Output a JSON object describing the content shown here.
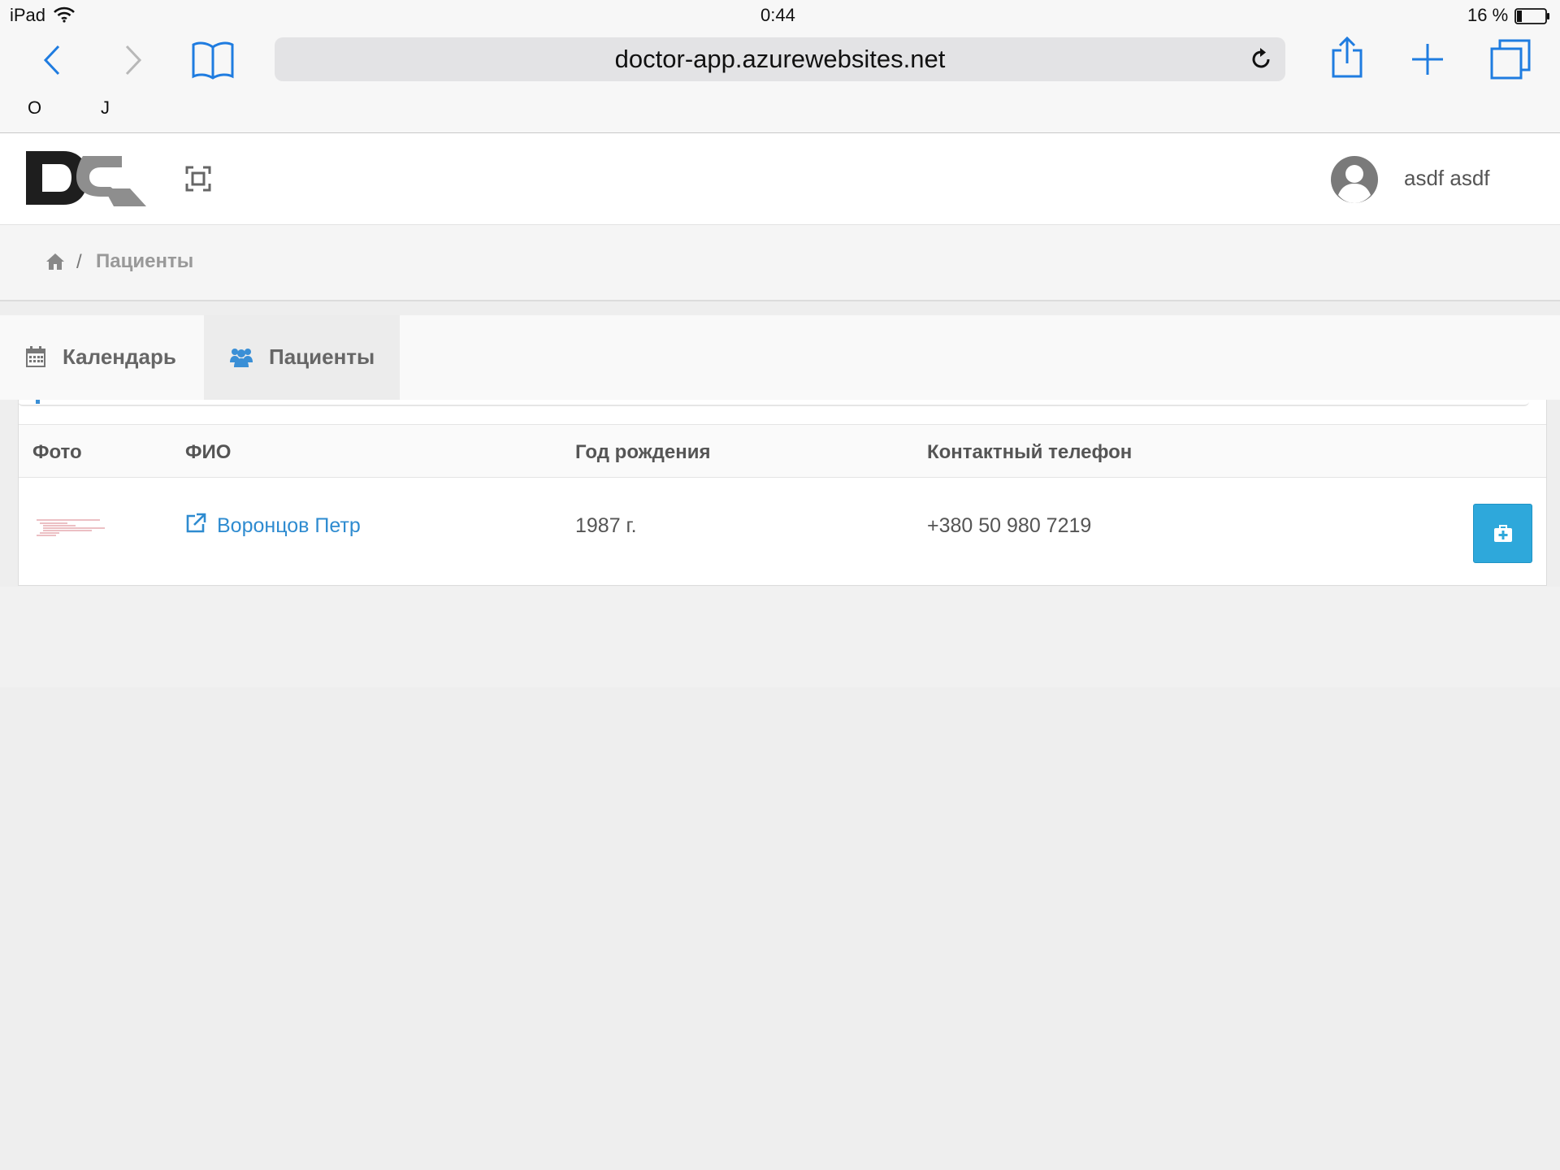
{
  "status_bar": {
    "device": "iPad",
    "time": "0:44",
    "battery": "16 %"
  },
  "browser": {
    "url": "doctor-app.azurewebsites.net",
    "favorites": [
      "O",
      "J"
    ]
  },
  "header": {
    "user_name": "asdf asdf"
  },
  "breadcrumb": {
    "separator": "/",
    "current": "Пациенты"
  },
  "tabs": [
    {
      "label": "Календарь",
      "icon": "calendar-icon"
    },
    {
      "label": "Пациенты",
      "icon": "users-icon",
      "active": true
    }
  ],
  "table": {
    "headers": [
      "Фото",
      "ФИО",
      "Год рождения",
      "Контактный телефон"
    ],
    "rows": [
      {
        "name": "Воронцов Петр",
        "birth_year": "1987 г.",
        "phone": "+380 50 980 7219"
      }
    ]
  },
  "colors": {
    "accent": "#2e8bd0",
    "action_button": "#2ea8db"
  }
}
